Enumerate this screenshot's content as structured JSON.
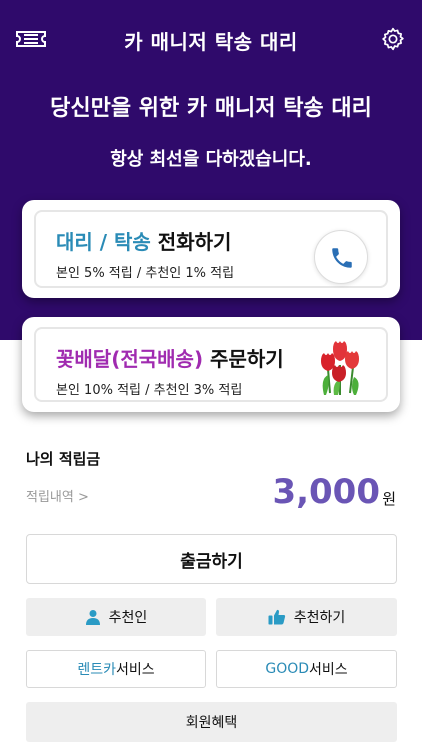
{
  "app": {
    "title": "카 매니저 탁송 대리"
  },
  "hero": {
    "headline": "당신만을 위한 카 매니저 탁송 대리",
    "subline": "항상 최선을 다하겠습니다."
  },
  "cards": {
    "call": {
      "title_accent": "대리 / 탁송",
      "title_rest": " 전화하기",
      "desc": "본인 5% 적립 / 추천인 1% 적립",
      "accent_color": "#2a8bb6"
    },
    "flower": {
      "title_accent": "꽃배달(전국배송)",
      "title_rest": " 주문하기",
      "desc": "본인 10% 적립 / 추천인 3% 적립",
      "accent_color": "#a02bb0"
    }
  },
  "points": {
    "label": "나의 적립금",
    "history_link": "적립내역 >",
    "amount": "3,000",
    "unit": "원"
  },
  "buttons": {
    "withdraw": "출금하기",
    "recommender": "추천인",
    "recommend": "추천하기",
    "rent_accent": "렌트카",
    "rent_rest": " 서비스",
    "good_accent": "GOOD",
    "good_rest": " 서비스",
    "benefits": "회원혜택"
  },
  "icons": {
    "menu": "ticket-icon",
    "settings": "gear-icon",
    "phone": "phone-icon",
    "flower": "tulip-icon",
    "recommender": "person-icon",
    "recommend": "thumbs-up-icon"
  },
  "colors": {
    "hero_bg": "#2f0a6b",
    "accent_blue": "#2a8bb6",
    "accent_purple": "#a02bb0",
    "amount": "#6a55b5"
  }
}
